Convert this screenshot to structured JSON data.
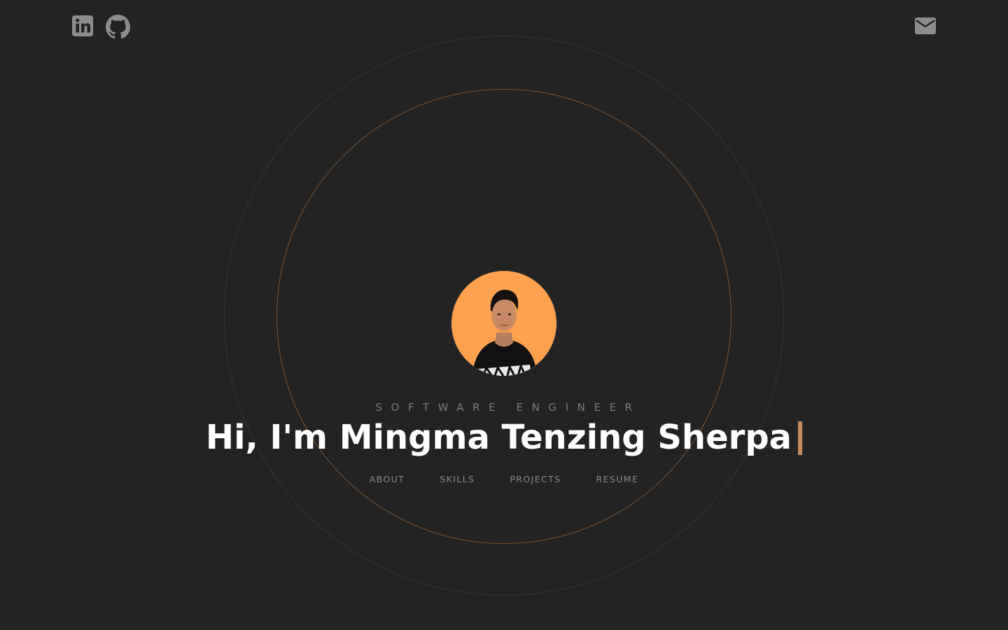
{
  "social": {
    "linkedin_icon": "linkedin-icon",
    "github_icon": "github-icon",
    "email_icon": "mail-icon"
  },
  "hero": {
    "subtitle": "SOFTWARE ENGINEER",
    "headline": "Hi, I'm Mingma Tenzing Sherpa"
  },
  "nav": {
    "items": [
      {
        "label": "ABOUT"
      },
      {
        "label": "SKILLS"
      },
      {
        "label": "PROJECTS"
      },
      {
        "label": "RESUME"
      }
    ]
  },
  "colors": {
    "background": "#232323",
    "accent": "#c98a57",
    "avatar_background": "#ffa14e",
    "text": "#ffffff",
    "muted_text": "#8b8b95"
  }
}
